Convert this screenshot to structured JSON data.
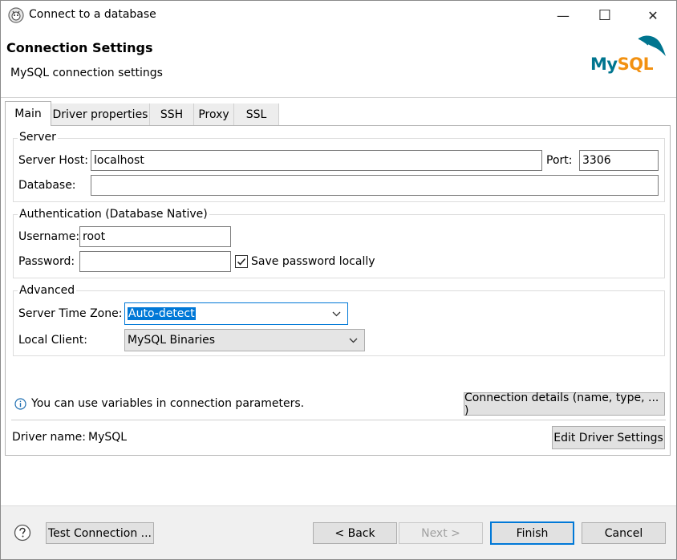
{
  "window": {
    "title": "Connect to a database",
    "minimize_glyph": "—",
    "maximize_glyph": "☐",
    "close_glyph": "✕"
  },
  "header": {
    "title": "Connection Settings",
    "subtitle": "MySQL connection settings",
    "logo_text": "MySQL",
    "logo_colors": {
      "my": "#00758f",
      "sql": "#f29111"
    }
  },
  "tabs": [
    {
      "label": "Main",
      "active": true
    },
    {
      "label": "Driver properties"
    },
    {
      "label": "SSH"
    },
    {
      "label": "Proxy"
    },
    {
      "label": "SSL"
    }
  ],
  "server": {
    "legend": "Server",
    "host_label": "Server Host:",
    "host_value": "localhost",
    "port_label": "Port:",
    "port_value": "3306",
    "database_label": "Database:",
    "database_value": ""
  },
  "auth": {
    "legend": "Authentication (Database Native)",
    "username_label": "Username:",
    "username_value": "root",
    "password_label": "Password:",
    "password_value": "",
    "save_password_label": "Save password locally",
    "save_password_checked": true
  },
  "advanced": {
    "legend": "Advanced",
    "timezone_label": "Server Time Zone:",
    "timezone_value": "Auto-detect",
    "local_client_label": "Local Client:",
    "local_client_value": "MySQL Binaries"
  },
  "info": {
    "icon": "info-icon",
    "text": "You can use variables in connection parameters.",
    "details_button": "Connection details (name, type, ... )"
  },
  "driver": {
    "label": "Driver name:",
    "value": "MySQL",
    "edit_button": "Edit Driver Settings"
  },
  "footer": {
    "help_icon": "help-icon",
    "test_button": "Test Connection ...",
    "back_button": "< Back",
    "next_button": "Next >",
    "finish_button": "Finish",
    "cancel_button": "Cancel"
  }
}
